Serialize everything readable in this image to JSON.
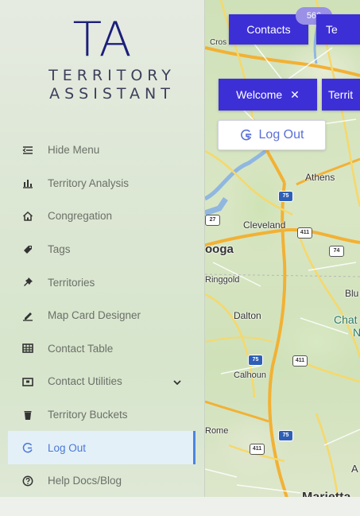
{
  "logo": {
    "mark": "TA",
    "line1": "TERRITORY",
    "line2": "ASSISTANT"
  },
  "nav": {
    "items": [
      {
        "label": "Hide Menu",
        "icon": "hide-menu-icon"
      },
      {
        "label": "Territory Analysis",
        "icon": "bar-chart-icon"
      },
      {
        "label": "Congregation",
        "icon": "home-icon"
      },
      {
        "label": "Tags",
        "icon": "tag-icon"
      },
      {
        "label": "Territories",
        "icon": "pin-icon"
      },
      {
        "label": "Map Card Designer",
        "icon": "pen-icon"
      },
      {
        "label": "Contact Table",
        "icon": "table-icon"
      },
      {
        "label": "Contact Utilities",
        "icon": "toolbox-icon",
        "expandable": true
      },
      {
        "label": "Territory Buckets",
        "icon": "bucket-icon"
      },
      {
        "label": "Log Out",
        "icon": "logout-icon",
        "active": true
      },
      {
        "label": "Help Docs/Blog",
        "icon": "help-icon"
      }
    ]
  },
  "map_overlay": {
    "contacts_label": "Contacts",
    "contacts_count": "566",
    "territory_partial": "Te",
    "welcome_label": "Welcome",
    "welcome_close": "✕",
    "territ_partial": "Territ",
    "logout_label": "Log Out"
  },
  "map": {
    "labels": {
      "athens": "Athens",
      "cleveland": "Cleveland",
      "ooga": "ooga",
      "ringgold": "Ringgold",
      "blu": "Blu",
      "dalton": "Dalton",
      "chat": "Chat",
      "n": "N",
      "calhoun": "Calhoun",
      "rome": "Rome",
      "a": "A",
      "marietta": "Marietta",
      "cros": "Cros"
    },
    "shields": {
      "i75_a": "75",
      "us411_a": "411",
      "us74": "74",
      "i75_b": "75",
      "us411_b": "411",
      "i75_c": "75",
      "us411_c": "411",
      "us27": "27"
    }
  },
  "colors": {
    "accent": "#3d2fd6",
    "logo": "#1b1f7a",
    "active_item_text": "#4a78d6",
    "active_item_bg": "#e4f0f8"
  }
}
